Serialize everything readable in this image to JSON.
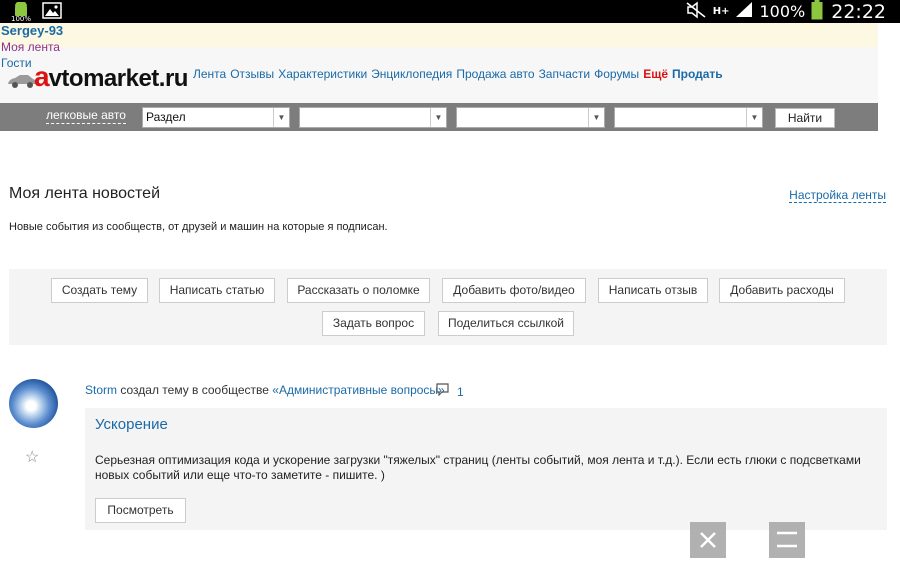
{
  "status_bar": {
    "battery_small": "100%",
    "network": "H+",
    "battery": "100%",
    "time": "22:22",
    "icons": [
      "android-icon",
      "image-icon",
      "mute-icon",
      "signal-icon",
      "battery-icon"
    ]
  },
  "user": {
    "name": "Sergey-93",
    "my_feed": "Моя лента",
    "guests": "Гости"
  },
  "logo": {
    "accent": "a",
    "rest": "vtomarket.ru"
  },
  "nav": {
    "items": [
      "Лента",
      "Отзывы",
      "Характеристики",
      "Энциклопедия",
      "Продажа авто",
      "Запчасти",
      "Форумы"
    ],
    "more": "Ещё",
    "sell": "Продать"
  },
  "filter": {
    "category_label": "легковые авто",
    "section_select": "Раздел",
    "select2": "",
    "select3": "",
    "select4": "",
    "find_button": "Найти"
  },
  "page": {
    "title": "Моя лента новостей",
    "settings_link": "Настройка ленты",
    "subtitle": "Новые события из сообществ, от друзей и машин на которые я подписан."
  },
  "actions": {
    "create_topic": "Создать тему",
    "write_article": "Написать статью",
    "tell_breakdown": "Рассказать о поломке",
    "add_media": "Добавить фото/видео",
    "write_review": "Написать отзыв",
    "add_expenses": "Добавить расходы",
    "ask_question": "Задать вопрос",
    "share_link": "Поделиться ссылкой"
  },
  "feed": {
    "author": "Storm",
    "action_text": "создал тему в сообществе",
    "community": "«Административные вопросы»",
    "comments_count": "1",
    "post_title": "Ускорение",
    "post_text": "Серьезная оптимизация кода и ускорение загрузки \"тяжелых\" страниц (ленты событий, моя лента и т.д.). Если есть глюки с подсветками новых событий или еще что-то заметите - пишите. )",
    "view_button": "Посмотреть"
  },
  "colors": {
    "link": "#1a6aa8",
    "accent_red": "#dd1111",
    "filter_bar": "#7d7d7d",
    "panel": "#f4f4f4"
  }
}
